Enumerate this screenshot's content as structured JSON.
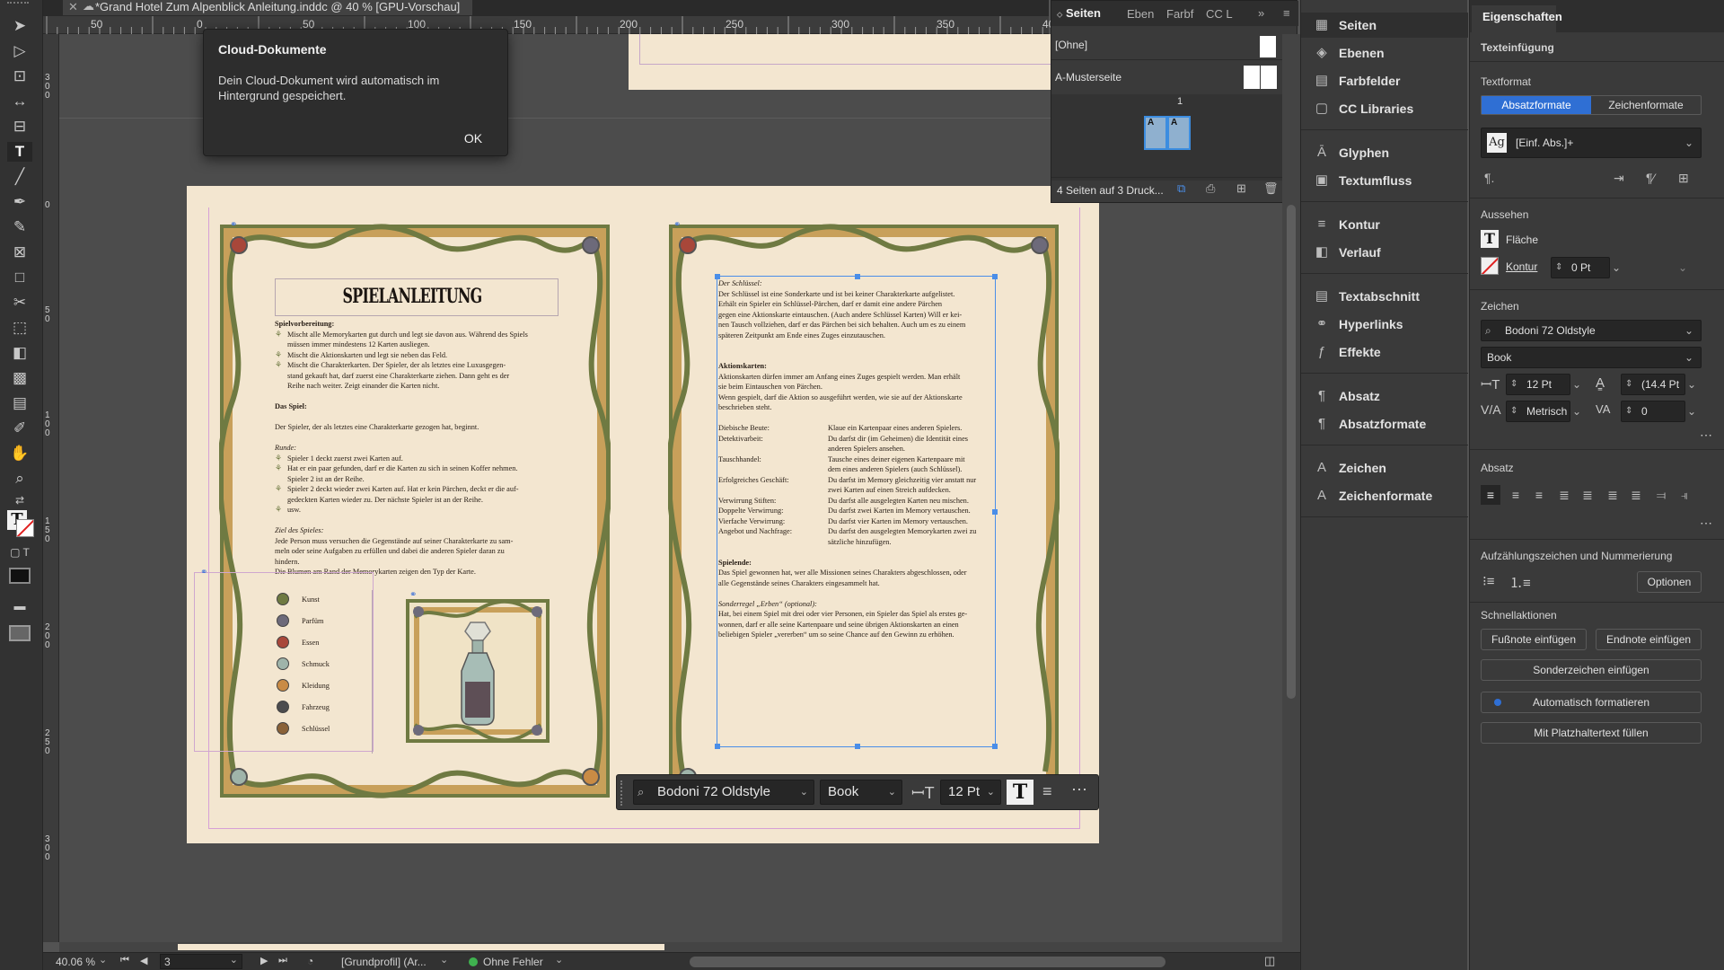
{
  "window": {
    "doc_title": "*Grand Hotel Zum Alpenblick Anleitung.inddc @ 40 % [GPU-Vorschau]"
  },
  "hruler": [
    "50",
    "0",
    "50",
    "100",
    "150",
    "200",
    "250",
    "300",
    "350",
    "400"
  ],
  "vruler": [
    "300",
    "0",
    "50",
    "100",
    "150",
    "200",
    "250",
    "300"
  ],
  "cloud_dialog": {
    "title": "Cloud-Dokumente",
    "message": "Dein Cloud-Dokument wird automatisch im Hintergrund gespeichert.",
    "ok": "OK"
  },
  "page1": {
    "heading": "SPIELANLEITUNG",
    "lines": [
      {
        "t": "Spielvorbereitung:",
        "s": "b"
      },
      {
        "t": "Mischt alle Memorykarten gut durch und legt sie davon aus. Während des Spiels",
        "s": "bullet"
      },
      {
        "t": "müssen immer mindestens 12 Karten ausliegen.",
        "s": "indent"
      },
      {
        "t": "Mischt die Aktionskarten und legt sie neben das Feld.",
        "s": "bullet"
      },
      {
        "t": "Mischt die Charakterkarten. Der Spieler, der als letztes eine Luxusgegen-",
        "s": "bullet"
      },
      {
        "t": "stand gekauft hat, darf zuerst eine Charakterkarte ziehen. Dann geht es der",
        "s": "indent"
      },
      {
        "t": "Reihe nach weiter. Zeigt einander die Karten nicht.",
        "s": "indent"
      },
      {
        "t": "",
        "s": ""
      },
      {
        "t": "Das Spiel:",
        "s": "b"
      },
      {
        "t": "",
        "s": ""
      },
      {
        "t": "Der Spieler, der als letztes eine Charakterkarte gezogen hat, beginnt.",
        "s": ""
      },
      {
        "t": "",
        "s": ""
      },
      {
        "t": "Runde:",
        "s": "i"
      },
      {
        "t": "Spieler 1 deckt zuerst zwei Karten auf.",
        "s": "bullet"
      },
      {
        "t": "Hat er ein paar gefunden, darf er die Karten zu sich in seinen Koffer nehmen.",
        "s": "bullet"
      },
      {
        "t": "Spieler 2 ist an der Reihe.",
        "s": "indent"
      },
      {
        "t": "Spieler 2 deckt wieder zwei Karten auf. Hat er kein Pärchen, deckt er die auf-",
        "s": "bullet"
      },
      {
        "t": "gedeckten Karten wieder zu. Der nächste Spieler ist an der Reihe.",
        "s": "indent"
      },
      {
        "t": "usw.",
        "s": "bullet"
      },
      {
        "t": "",
        "s": ""
      },
      {
        "t": "Ziel des Spieles:",
        "s": "i"
      },
      {
        "t": "Jede Person muss versuchen die Gegenstände auf seiner Charakterkarte zu sam-",
        "s": ""
      },
      {
        "t": "meln oder seine Aufgaben zu erfüllen und dabei die anderen Spieler daran zu",
        "s": ""
      },
      {
        "t": "hindern.",
        "s": ""
      },
      {
        "t": "Die Blumen am Rand der Memorykarten zeigen den Typ der Karte.",
        "s": ""
      }
    ],
    "legend": [
      {
        "label": "Kunst",
        "color": "#6f7a42"
      },
      {
        "label": "Parfüm",
        "color": "#6d6a7a"
      },
      {
        "label": "Essen",
        "color": "#a8473a"
      },
      {
        "label": "Schmuck",
        "color": "#9fb4aa"
      },
      {
        "label": "Kleidung",
        "color": "#c98b45"
      },
      {
        "label": "Fahrzeug",
        "color": "#4c4c4e"
      },
      {
        "label": "Schlüssel",
        "color": "#8a6238"
      }
    ]
  },
  "page2": {
    "lines": [
      {
        "t": "Der Schlüssel:",
        "s": "i"
      },
      {
        "t": "Der Schlüssel ist eine Sonderkarte und ist bei keiner Charakterkarte aufgelistet.",
        "s": ""
      },
      {
        "t": "Erhält ein Spieler ein Schlüssel-Pärchen, darf er damit eine andere Pärchen",
        "s": ""
      },
      {
        "t": "gegen eine Aktionskarte eintauschen. (Auch andere Schlüssel Karten) Will er kei-",
        "s": ""
      },
      {
        "t": "nen Tausch vollziehen, darf er das Pärchen bei sich behalten. Auch um es zu einem",
        "s": ""
      },
      {
        "t": "späteren Zeitpunkt am Ende eines Zuges einzutauschen.",
        "s": ""
      },
      {
        "t": "",
        "s": ""
      },
      {
        "t": "",
        "s": ""
      },
      {
        "t": "Aktionskarten:",
        "s": "b"
      },
      {
        "t": "Aktionskarten dürfen immer am Anfang eines Zuges gespielt werden. Man erhält",
        "s": ""
      },
      {
        "t": "sie beim Eintauschen von Pärchen.",
        "s": ""
      },
      {
        "t": "Wenn gespielt, darf die Aktion so ausgeführt werden, wie sie auf der Aktionskarte",
        "s": ""
      },
      {
        "t": "beschrieben steht.",
        "s": ""
      },
      {
        "t": "",
        "s": ""
      }
    ],
    "actions": [
      {
        "k": "Diebische Beute:",
        "v": "Klaue ein Kartenpaar eines anderen Spielers."
      },
      {
        "k": "Detektivarbeit:",
        "v": "Du darfst dir (im Geheimen) die Identität eines"
      },
      {
        "k": "",
        "v": "anderen Spielers ansehen."
      },
      {
        "k": "Tauschhandel:",
        "v": "Tausche eines deiner eigenen Kartenpaare mit"
      },
      {
        "k": "",
        "v": "dem eines anderen Spielers (auch Schlüssel)."
      },
      {
        "k": "Erfolgreiches Geschäft:",
        "v": "Du darfst im Memory gleichzeitig vier anstatt nur"
      },
      {
        "k": "",
        "v": "zwei Karten auf einen Streich aufdecken."
      },
      {
        "k": "Verwirrung Stiften:",
        "v": "Du darfst alle ausgelegten Karten neu mischen."
      },
      {
        "k": "Doppelte Verwirrung:",
        "v": "Du darfst zwei Karten im Memory vertauschen."
      },
      {
        "k": "Vierfache Verwirrung:",
        "v": "Du darfst vier Karten im Memory vertauschen."
      },
      {
        "k": "Angebot und Nachfrage:",
        "v": "Du darfst den ausgelegten Memorykarten zwei zu"
      },
      {
        "k": "",
        "v": "sätzliche hinzufügen."
      }
    ],
    "lines2": [
      {
        "t": "Spielende:",
        "s": "b"
      },
      {
        "t": "Das Spiel gewonnen hat, wer alle Missionen seines Charakters abgeschlossen, oder",
        "s": ""
      },
      {
        "t": "alle Gegenstände seines Charakters eingesammelt hat.",
        "s": ""
      },
      {
        "t": "",
        "s": ""
      },
      {
        "t": "Sonderregel „Erben“ (optional):",
        "s": "i"
      },
      {
        "t": "Hat, bei einem Spiel mit drei oder vier Personen, ein Spieler das Spiel als erstes ge-",
        "s": ""
      },
      {
        "t": "wonnen, darf er alle seine Kartenpaare und seine übrigen Aktionskarten an einen",
        "s": ""
      },
      {
        "t": "beliebigen Spieler „vererben“ um so seine Chance auf den Gewinn zu erhöhen.",
        "s": ""
      }
    ]
  },
  "ctrlbar": {
    "font": "Bodoni 72 Oldstyle",
    "style": "Book",
    "size": "12 Pt"
  },
  "seiten_panel": {
    "tabs": [
      "Seiten",
      "Eben",
      "Farbf",
      "CC L"
    ],
    "masters": [
      "[Ohne]",
      "A-Musterseite"
    ],
    "page_number": "1",
    "page_label": "A",
    "footer": "4 Seiten auf 3 Druck..."
  },
  "mid_panel": {
    "groups": [
      [
        {
          "label": "Seiten",
          "icon": "pages-icon",
          "glyph": "▦"
        },
        {
          "label": "Ebenen",
          "icon": "layers-icon",
          "glyph": "◈"
        },
        {
          "label": "Farbfelder",
          "icon": "swatches-icon",
          "glyph": "▤"
        },
        {
          "label": "CC Libraries",
          "icon": "cc-libraries-icon",
          "glyph": "▢"
        }
      ],
      [
        {
          "label": "Glyphen",
          "icon": "glyphs-icon",
          "glyph": "Ā"
        },
        {
          "label": "Textumfluss",
          "icon": "text-wrap-icon",
          "glyph": "▣"
        }
      ],
      [
        {
          "label": "Kontur",
          "icon": "stroke-icon",
          "glyph": "≡"
        },
        {
          "label": "Verlauf",
          "icon": "gradient-icon",
          "glyph": "◧"
        }
      ],
      [
        {
          "label": "Textabschnitt",
          "icon": "story-icon",
          "glyph": "▤"
        },
        {
          "label": "Hyperlinks",
          "icon": "hyperlinks-icon",
          "glyph": "⚭"
        },
        {
          "label": "Effekte",
          "icon": "effects-icon",
          "glyph": "ƒ"
        }
      ],
      [
        {
          "label": "Absatz",
          "icon": "paragraph-icon",
          "glyph": "¶"
        },
        {
          "label": "Absatzformate",
          "icon": "paragraph-styles-icon",
          "glyph": "¶"
        }
      ],
      [
        {
          "label": "Zeichen",
          "icon": "character-icon",
          "glyph": "A"
        },
        {
          "label": "Zeichenformate",
          "icon": "character-styles-icon",
          "glyph": "A"
        }
      ]
    ]
  },
  "props": {
    "title": "Eigenschaften",
    "text_insertion": "Texteinfügung",
    "textformat": "Textformat",
    "tab_paragraph": "Absatzformate",
    "tab_character": "Zeichenformate",
    "style_value": "[Einf. Abs.]+",
    "style_icon_label": "Ag",
    "appearance": "Aussehen",
    "fill": "Fläche",
    "stroke": "Kontur",
    "stroke_weight": "0 Pt",
    "character": "Zeichen",
    "font": "Bodoni 72 Oldstyle",
    "style": "Book",
    "size": "12 Pt",
    "leading": "(14.4 Pt",
    "kerning": "Metrisch",
    "tracking": "0",
    "paragraph": "Absatz",
    "bullets": "Aufzählungszeichen und Nummerierung",
    "options": "Optionen",
    "quick_actions": "Schnellaktionen",
    "footnote": "Fußnote einfügen",
    "endnote": "Endnote einfügen",
    "special_char": "Sonderzeichen einfügen",
    "auto_format": "Automatisch formatieren",
    "placeholder": "Mit Platzhaltertext füllen"
  },
  "status": {
    "zoom": "40.06 %",
    "page": "3",
    "profile": "[Grundprofil] (Ar...",
    "preflight": "Ohne Fehler"
  }
}
